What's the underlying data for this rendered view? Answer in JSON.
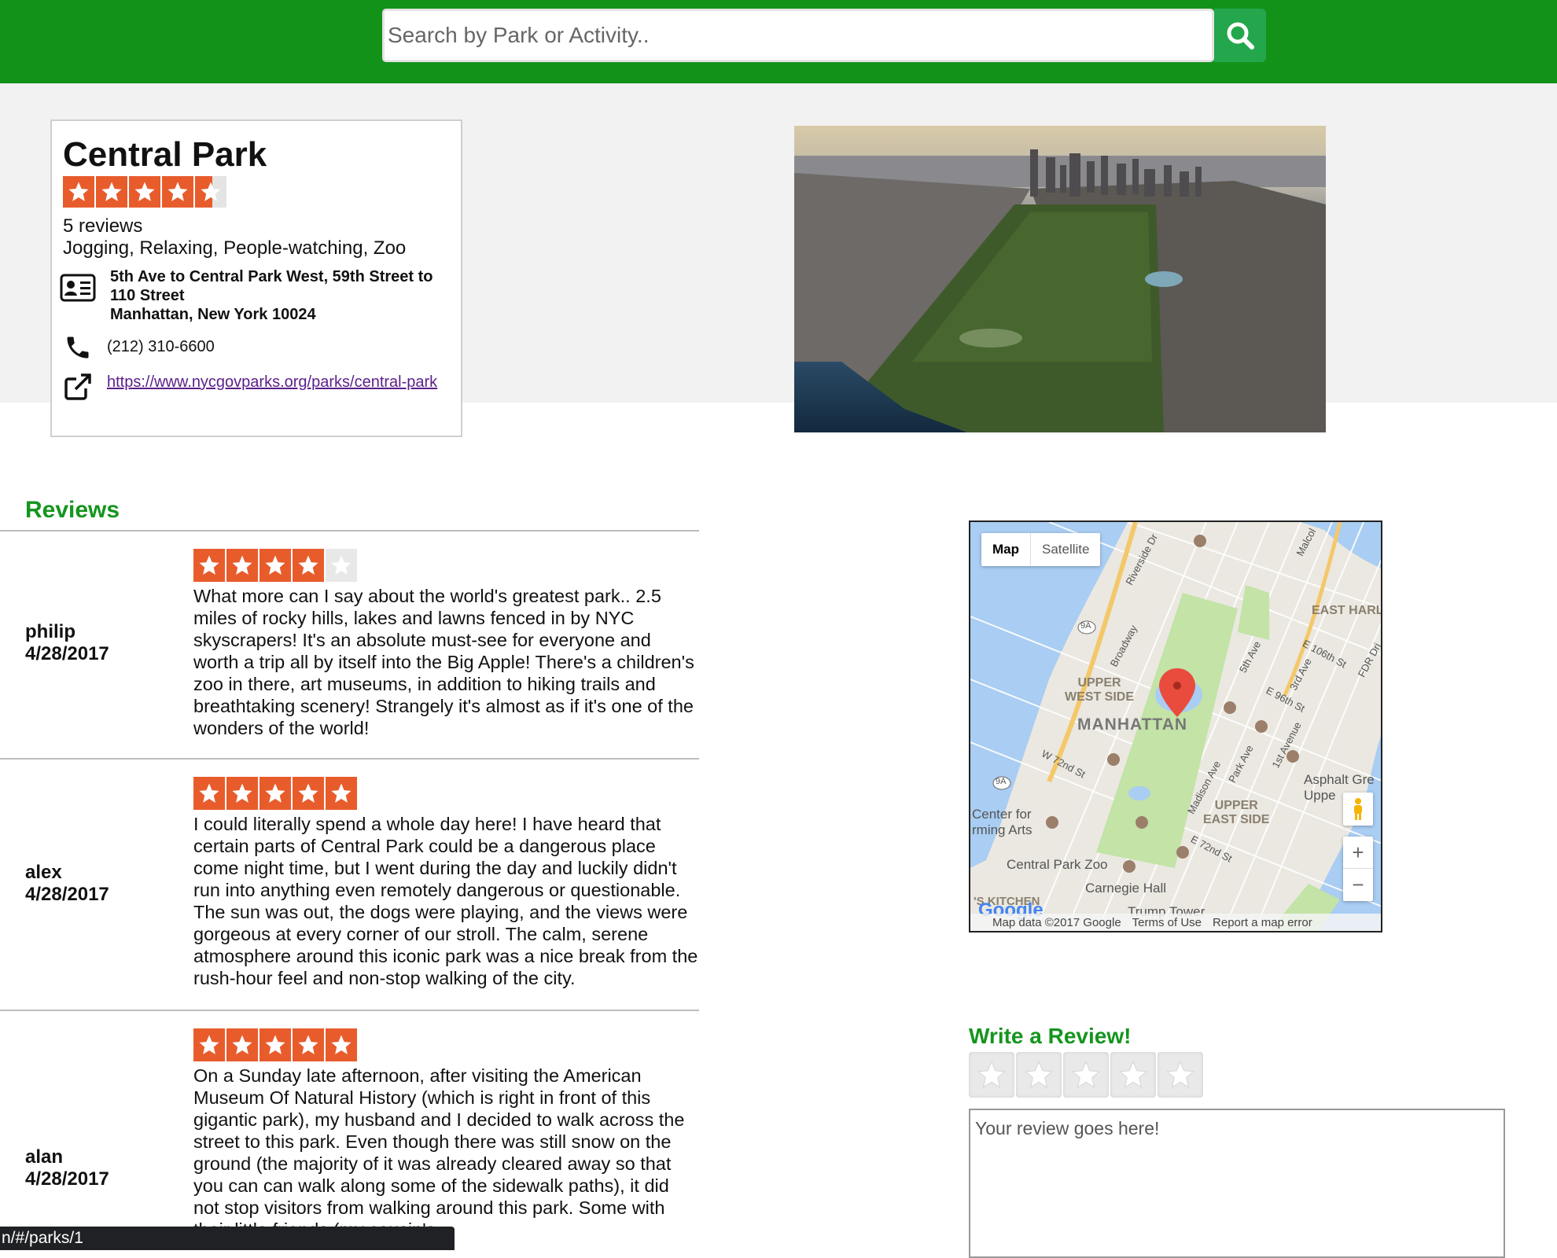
{
  "search": {
    "placeholder": "Search by Park or Activity.."
  },
  "icons": {
    "search": "search-icon",
    "address": "contact-card-icon",
    "phone": "phone-icon",
    "link": "external-link-icon"
  },
  "colors": {
    "header": "#13921a",
    "accent_green": "#15951e",
    "star_orange": "#e85c2c",
    "star_empty": "#e8e8e8"
  },
  "park": {
    "name": "Central Park",
    "rating": 4.5,
    "reviews": "5 reviews",
    "activities": "Jogging, Relaxing, People-watching, Zoo",
    "address_line1": "5th Ave to Central Park West, 59th Street to 110 Street",
    "address_line2": "Manhattan, New York 10024",
    "phone": "(212) 310-6600",
    "website": "https://www.nycgovparks.org/parks/central-park"
  },
  "reviews_section": {
    "title": "Reviews",
    "items": [
      {
        "user": "philip",
        "date": "4/28/2017",
        "rating": 4,
        "text": "What more can I say about the world's greatest park.. 2.5 miles of rocky hills, lakes and lawns fenced in by NYC skyscrapers! It's an absolute must-see for everyone and worth a trip all by itself into the Big Apple! There's a children's zoo in there, art museums, in addition to hiking trails and breathtaking scenery! Strangely it's almost as if it's one of the wonders of the world!"
      },
      {
        "user": "alex",
        "date": "4/28/2017",
        "rating": 5,
        "text": "I could literally spend a whole day here! I have heard that certain parts of Central Park could be a dangerous place come night time, but I went during the day and luckily didn't run into anything even remotely dangerous or questionable. The sun was out, the dogs were playing, and the views were gorgeous at every corner of our stroll. The calm, serene atmosphere around this iconic park was a nice break from the rush-hour feel and non-stop walking of the city."
      },
      {
        "user": "alan",
        "date": "4/28/2017",
        "rating": 5,
        "text": "On a Sunday late afternoon, after visiting the American Museum Of Natural History (which is right in front of this gigantic park), my husband and I decided to walk across the street to this park. Even though there was still snow on the ground (the majority of it was already cleared away so that you can can walk along some of the sidewalk paths), it did not stop visitors from walking around this park. Some with their little friends (my cousin's"
      }
    ]
  },
  "map": {
    "type_map": "Map",
    "type_satellite": "Satellite",
    "labels": {
      "upper_west": "UPPER\nWEST SIDE",
      "manhattan": "MANHATTAN",
      "upper_east": "UPPER\nEAST SIDE",
      "east_harlem": "EAST HARL",
      "center_arts": "Center for\nrming Arts",
      "zoo": "Central Park Zoo",
      "carnegie": "Carnegie Hall",
      "kitchen": "'S KITCHEN",
      "trump": "Trump Tower",
      "asphalt": "Asphalt Gre",
      "uppe": "Uppe",
      "broadway": "Broadway",
      "riverside": "Riverside Dr",
      "w72": "W 72nd St",
      "e72": "E 72nd St",
      "e96": "E 96th St",
      "e106": "E 106th St",
      "fifth": "5th Ave",
      "madison": "Madison Ave",
      "park_ave": "Park Ave",
      "first": "1st Avenue",
      "third": "3rd Ave",
      "fdr": "FDR Dri",
      "malcol": "Malcol",
      "r9a": "9A"
    },
    "zoom_in": "+",
    "zoom_out": "−",
    "google": "Google",
    "map_data": "Map data ©2017 Google",
    "terms": "Terms of Use",
    "report": "Report a map error"
  },
  "write_review": {
    "title": "Write a Review!",
    "placeholder": "Your review goes here!"
  },
  "status_bar": {
    "url": "n/#/parks/1"
  }
}
